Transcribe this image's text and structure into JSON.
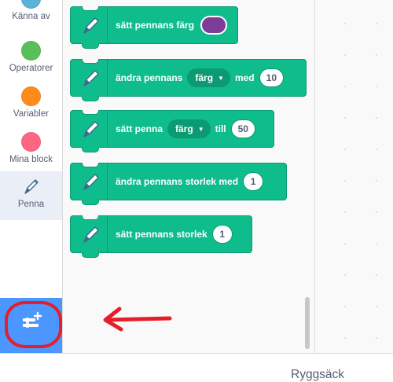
{
  "sidebar": {
    "categories": [
      {
        "label": "Känna av",
        "color": "#5cb1d6"
      },
      {
        "label": "Operatorer",
        "color": "#59c059"
      },
      {
        "label": "Variabler",
        "color": "#ff8c1a"
      },
      {
        "label": "Mina block",
        "color": "#ff6680"
      },
      {
        "label": "Penna",
        "icon": "pen-icon",
        "selected": true
      }
    ]
  },
  "blocks": [
    {
      "text": "sätt pennans färg",
      "swatch_color": "#7d3c98"
    },
    {
      "text": "ändra pennans",
      "dropdown": "färg",
      "text2": "med",
      "value": "10"
    },
    {
      "text": "sätt penna",
      "dropdown": "färg",
      "text2": "till",
      "value": "50"
    },
    {
      "text": "ändra pennans storlek med",
      "value": "1"
    },
    {
      "text": "sätt pennans storlek",
      "value": "1"
    }
  ],
  "colors": {
    "pen_block": "#0fbd8c",
    "pen_block_border": "#0b9a71",
    "extension_button": "#4c97ff",
    "annotation": "#e3202a"
  },
  "extension_button": {
    "icon": "add-extension-icon"
  },
  "backpack": {
    "label": "Ryggsäck"
  }
}
